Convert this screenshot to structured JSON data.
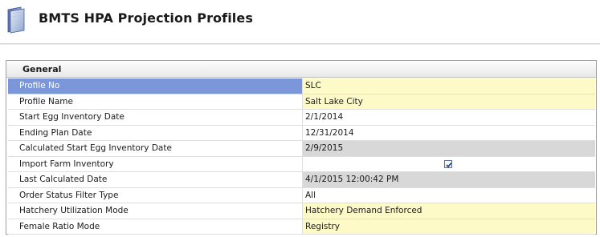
{
  "header": {
    "title": "BMTS HPA Projection Profiles",
    "icon": "document-icon"
  },
  "section": {
    "label": "General"
  },
  "colors": {
    "selected_row": "#7b97d9",
    "editable_value": "#fdfac8",
    "readonly_value": "#d8d8d8"
  },
  "rows": [
    {
      "label": "Profile No",
      "value": "SLC",
      "style": "yellow"
    },
    {
      "label": "Profile Name",
      "value": "Salt Lake City",
      "style": "yellow"
    },
    {
      "label": "Start Egg Inventory Date",
      "value": "2/1/2014",
      "style": "white"
    },
    {
      "label": "Ending Plan Date",
      "value": "12/31/2014",
      "style": "white"
    },
    {
      "label": "Calculated Start Egg Inventory Date",
      "value": "2/9/2015",
      "style": "gray"
    },
    {
      "label": "Import Farm Inventory",
      "value": "",
      "checked": true,
      "style": "white"
    },
    {
      "label": "Last Calculated Date",
      "value": "4/1/2015 12:00:42 PM",
      "style": "gray"
    },
    {
      "label": "Order Status Filter Type",
      "value": "All",
      "style": "white"
    },
    {
      "label": "Hatchery Utilization Mode",
      "value": "Hatchery Demand Enforced",
      "style": "yellow"
    },
    {
      "label": "Female Ratio Mode",
      "value": "Registry",
      "style": "yellow"
    }
  ]
}
